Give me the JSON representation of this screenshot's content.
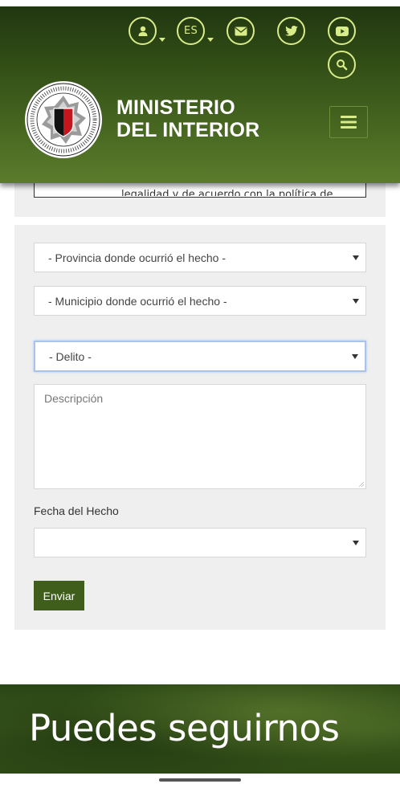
{
  "header": {
    "icons": [
      "user-icon",
      "language-selector",
      "mail-icon",
      "twitter-icon",
      "youtube-icon",
      "search-icon"
    ],
    "language": "ES",
    "brand_line1": "MINISTERIO",
    "brand_line2": "DEL INTERIOR",
    "colors": {
      "header_dark": "#1f3410",
      "header_light": "#5c7c2c",
      "icon_accent": "#d9ec8a"
    }
  },
  "clipped_text": "legalidad y de acuerdo con la política de",
  "form": {
    "province_select": "- Provincia donde ocurrió el hecho -",
    "municipality_select": "- Municipio donde ocurrió el hecho -",
    "crime_select": "- Delito -",
    "description_placeholder": "Descripción",
    "date_label": "Fecha del Hecho",
    "date_select": "",
    "submit_label": "Enviar",
    "submit_color": "#3f5e1b"
  },
  "banner": {
    "title": "Puedes seguirnos"
  }
}
